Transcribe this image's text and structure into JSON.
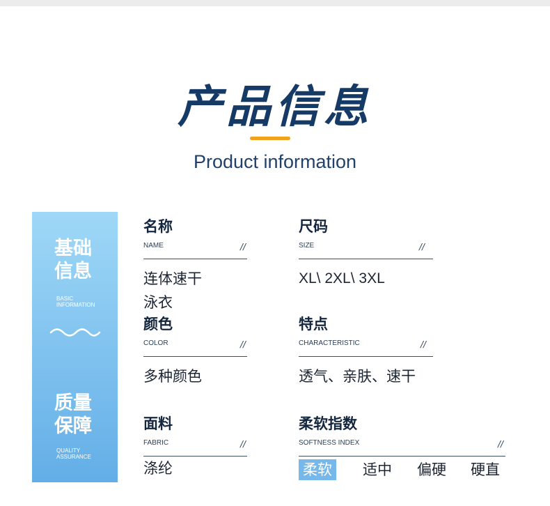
{
  "header": {
    "title": "产品信息",
    "subtitle": "Product information"
  },
  "sidebar": {
    "section1_line1": "基础",
    "section1_line2": "信息",
    "section1_en_line1": "BASIC",
    "section1_en_line2": "INFORMATION",
    "section2_line1": "质量",
    "section2_line2": "保障",
    "section2_en_line1": "QUALITY",
    "section2_en_line2": "ASSURANCE"
  },
  "fields": {
    "name": {
      "label": "名称",
      "en": "NAME",
      "value_line1": "连体速干",
      "value_line2": "泳衣"
    },
    "size": {
      "label": "尺码",
      "en": "SIZE",
      "value": "XL\\ 2XL\\ 3XL"
    },
    "color": {
      "label": "颜色",
      "en": "COLOR",
      "value": "多种颜色"
    },
    "feature": {
      "label": "特点",
      "en": "CHARACTERISTIC",
      "value": "透气、亲肤、速干"
    },
    "fabric": {
      "label": "面料",
      "en": "FABRIC",
      "value": "涤纶"
    },
    "softness": {
      "label": "柔软指数",
      "en": "SOFTNESS INDEX",
      "options": [
        "柔软",
        "适中",
        "偏硬",
        "硬直"
      ],
      "selected": "柔软"
    }
  },
  "slash": "//",
  "colors": {
    "accent_bar": "#f2a11a",
    "title": "#163a66",
    "highlight": "#77b8eb"
  }
}
